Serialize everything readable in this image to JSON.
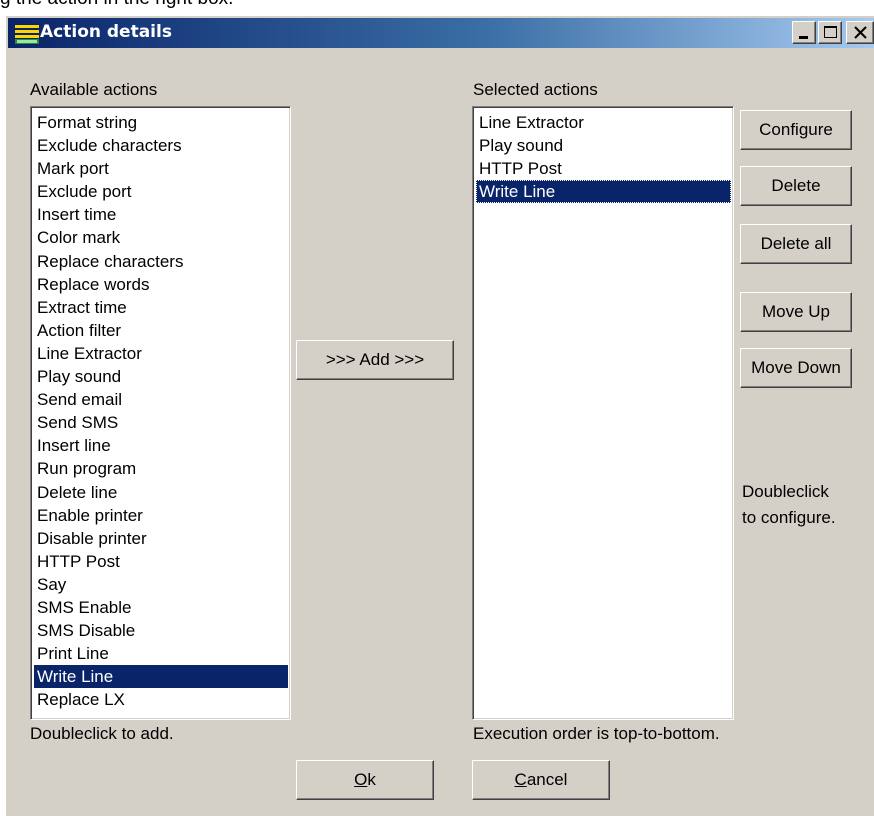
{
  "background_caption": "g the action in the right box.",
  "window": {
    "title": "Action details",
    "controls": {
      "minimize": "_",
      "maximize": "□",
      "close": "×"
    }
  },
  "available": {
    "label": "Available actions",
    "items": [
      "Format string",
      "Exclude characters",
      "Mark port",
      "Exclude port",
      "Insert time",
      "Color mark",
      "Replace characters",
      "Replace words",
      "Extract time",
      "Action filter",
      "Line Extractor",
      "Play sound",
      "Send email",
      "Send SMS",
      "Insert line",
      "Run program",
      "Delete line",
      "Enable printer",
      "Disable printer",
      "HTTP Post",
      "Say",
      "SMS Enable",
      "SMS Disable",
      "Print Line",
      "Write Line",
      "Replace LX"
    ],
    "selected": "Write Line",
    "hint": "Doubleclick to add."
  },
  "add_button": ">>> Add >>>",
  "selected": {
    "label": "Selected actions",
    "items": [
      "Line Extractor",
      "Play sound",
      "HTTP Post",
      "Write Line"
    ],
    "selected": "Write Line",
    "hint": "Execution order is top-to-bottom."
  },
  "side_buttons": {
    "configure": "Configure",
    "delete": "Delete",
    "delete_all": "Delete all",
    "move_up": "Move Up",
    "move_down": "Move Down"
  },
  "configure_hint": {
    "line1": "Doubleclick",
    "line2": "to configure."
  },
  "ok_button": {
    "mnemonic": "O",
    "rest": "k"
  },
  "cancel_button": {
    "mnemonic": "C",
    "rest": "ancel"
  },
  "colors": {
    "face": "#d4d0c8",
    "selection": "#0a246a",
    "title_start": "#0a246a",
    "title_end": "#a6caf0"
  }
}
